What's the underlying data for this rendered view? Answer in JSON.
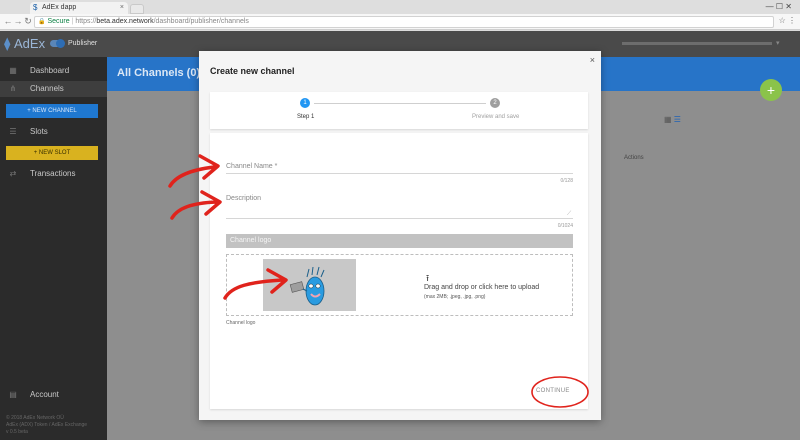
{
  "browser": {
    "tab_title": "AdEx dapp",
    "secure_label": "Secure",
    "url_scheme": "https://",
    "url_host": "beta.adex.network",
    "url_path": "/dashboard/publisher/channels"
  },
  "app": {
    "logo_text": "AdEx",
    "mode_label": "Publisher"
  },
  "sidebar": {
    "items": [
      {
        "label": "Dashboard",
        "icon": "dashboard-icon"
      },
      {
        "label": "Channels",
        "icon": "channels-icon"
      },
      {
        "label": "Slots",
        "icon": "slots-icon"
      },
      {
        "label": "Transactions",
        "icon": "transactions-icon"
      }
    ],
    "new_channel_label": "+ NEW CHANNEL",
    "new_slot_label": "+ NEW SLOT",
    "account_label": "Account",
    "footer_lines": [
      "© 2018 AdEx Network OÜ",
      "AdEx (ADX) Token / AdEx Exchange",
      "v 0.5 beta"
    ]
  },
  "main": {
    "title": "All Channels (0)",
    "actions_col": "Actions",
    "fab_label": "+"
  },
  "modal": {
    "title": "Create new channel",
    "close": "×",
    "steps": [
      {
        "number": "1",
        "label": "Step 1"
      },
      {
        "number": "2",
        "label": "Preview and save"
      }
    ],
    "channel_name_label": "Channel Name *",
    "channel_name_count": "0/128",
    "description_label": "Description",
    "description_count": "0/1024",
    "logo_header": "Channel logo",
    "upload_text": "Drag and drop or click here to upload",
    "upload_hint": "(max 2MB; .jpeg, .jpg, .png)",
    "logo_caption": "Channel logo",
    "continue_label": "CONTINUE"
  },
  "colors": {
    "accent": "#2774c8",
    "annotation": "#e0231c",
    "new_channel": "#1f78d1",
    "new_slot": "#d9b21f",
    "fab": "#8bc34a"
  }
}
